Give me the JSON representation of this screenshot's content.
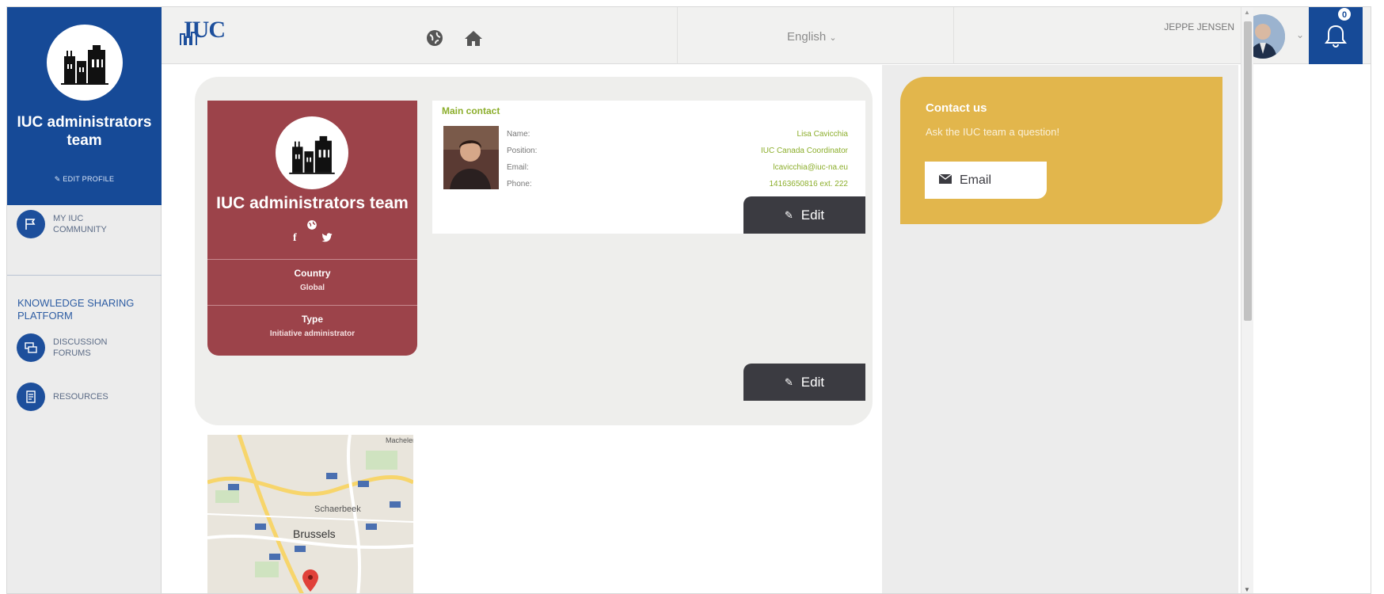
{
  "sidebar": {
    "org_name": "IUC administrators team",
    "edit_profile": "EDIT PROFILE",
    "my_community": "MY IUC COMMUNITY",
    "section_title": "KNOWLEDGE SHARING PLATFORM",
    "discussion_forums": "DISCUSSION FORUMS",
    "resources": "RESOURCES"
  },
  "topbar": {
    "brand": "IUC",
    "language": "English",
    "user_name": "JEPPE JENSEN",
    "notification_count": "0"
  },
  "org_card": {
    "name": "IUC administrators team",
    "country_label": "Country",
    "country_value": "Global",
    "type_label": "Type",
    "type_value": "Initiative administrator"
  },
  "contact": {
    "title": "Main contact",
    "keys": {
      "name": "Name:",
      "position": "Position:",
      "email": "Email:",
      "phone": "Phone:"
    },
    "values": {
      "name": "Lisa Cavicchia",
      "position": "IUC Canada Coordinator",
      "email": "lcavicchia@iuc-na.eu",
      "phone": "14163650816 ext. 222"
    },
    "edit_label": "Edit"
  },
  "panel": {
    "edit_label": "Edit"
  },
  "contact_us": {
    "title": "Contact us",
    "subtitle": "Ask the IUC team a question!",
    "email_label": "Email"
  },
  "map": {
    "labels": [
      "Schaerbeek",
      "Brussels",
      "Machelen"
    ]
  },
  "colors": {
    "brand_blue": "#164a97",
    "org_red": "#9c434a",
    "accent_green": "#8cae2c",
    "contact_yellow": "#e2b64c",
    "button_dark": "#3b3b41"
  }
}
